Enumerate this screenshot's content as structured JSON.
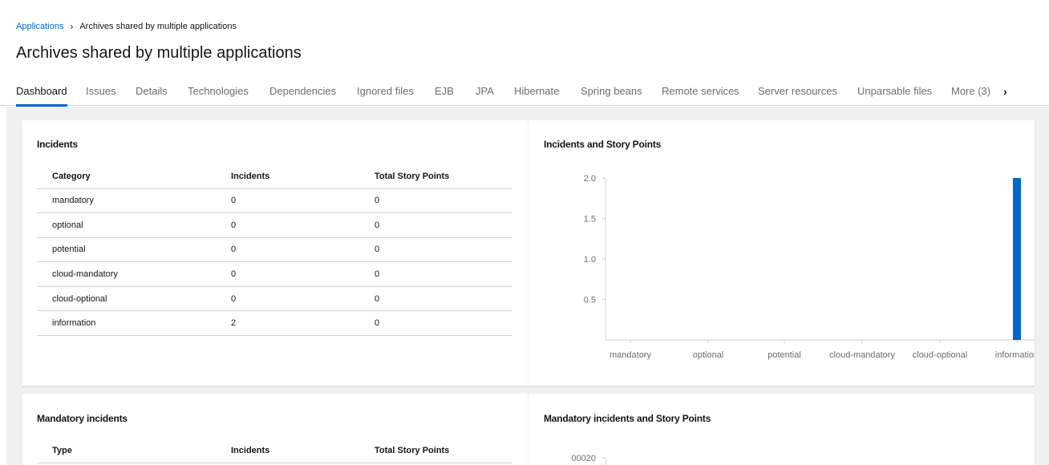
{
  "breadcrumb": {
    "root": "Applications",
    "separator": "›",
    "current": "Archives shared by multiple applications"
  },
  "page_title": "Archives shared by multiple applications",
  "tabs": [
    {
      "label": "Dashboard",
      "active": true
    },
    {
      "label": "Issues"
    },
    {
      "label": "Details"
    },
    {
      "label": "Technologies"
    },
    {
      "label": "Dependencies"
    },
    {
      "label": "Ignored files"
    },
    {
      "label": "EJB"
    },
    {
      "label": "JPA"
    },
    {
      "label": "Hibernate"
    },
    {
      "label": "Spring beans"
    },
    {
      "label": "Remote services"
    },
    {
      "label": "Server resources"
    },
    {
      "label": "Unparsable files"
    },
    {
      "label": "More (3)"
    }
  ],
  "tabs_scroll_icon": "chevron-right-icon",
  "incidents": {
    "title": "Incidents",
    "columns": [
      "Category",
      "Incidents",
      "Total Story Points"
    ],
    "rows": [
      [
        "mandatory",
        "0",
        "0"
      ],
      [
        "optional",
        "0",
        "0"
      ],
      [
        "potential",
        "0",
        "0"
      ],
      [
        "cloud-mandatory",
        "0",
        "0"
      ],
      [
        "cloud-optional",
        "0",
        "0"
      ],
      [
        "information",
        "2",
        "0"
      ]
    ]
  },
  "incidents_chart": {
    "title": "Incidents and Story Points"
  },
  "chart_data": [
    {
      "type": "bar",
      "title": "Incidents and Story Points",
      "categories": [
        "mandatory",
        "optional",
        "potential",
        "cloud-mandatory",
        "cloud-optional",
        "information"
      ],
      "values": [
        0,
        0,
        0,
        0,
        0,
        2
      ],
      "ylim": [
        0,
        2.0
      ],
      "yticks": [
        "2.0",
        "1.5",
        "1.0",
        "0.5"
      ],
      "color": "#0066cc",
      "grid": false
    },
    {
      "type": "bar",
      "title": "Mandatory incidents and Story Points",
      "yticks": [
        "00020"
      ],
      "grid": false
    }
  ],
  "mandatory": {
    "title": "Mandatory incidents",
    "columns": [
      "Type",
      "Incidents",
      "Total Story Points"
    ]
  },
  "mandatory_chart": {
    "title": "Mandatory incidents and Story Points"
  }
}
